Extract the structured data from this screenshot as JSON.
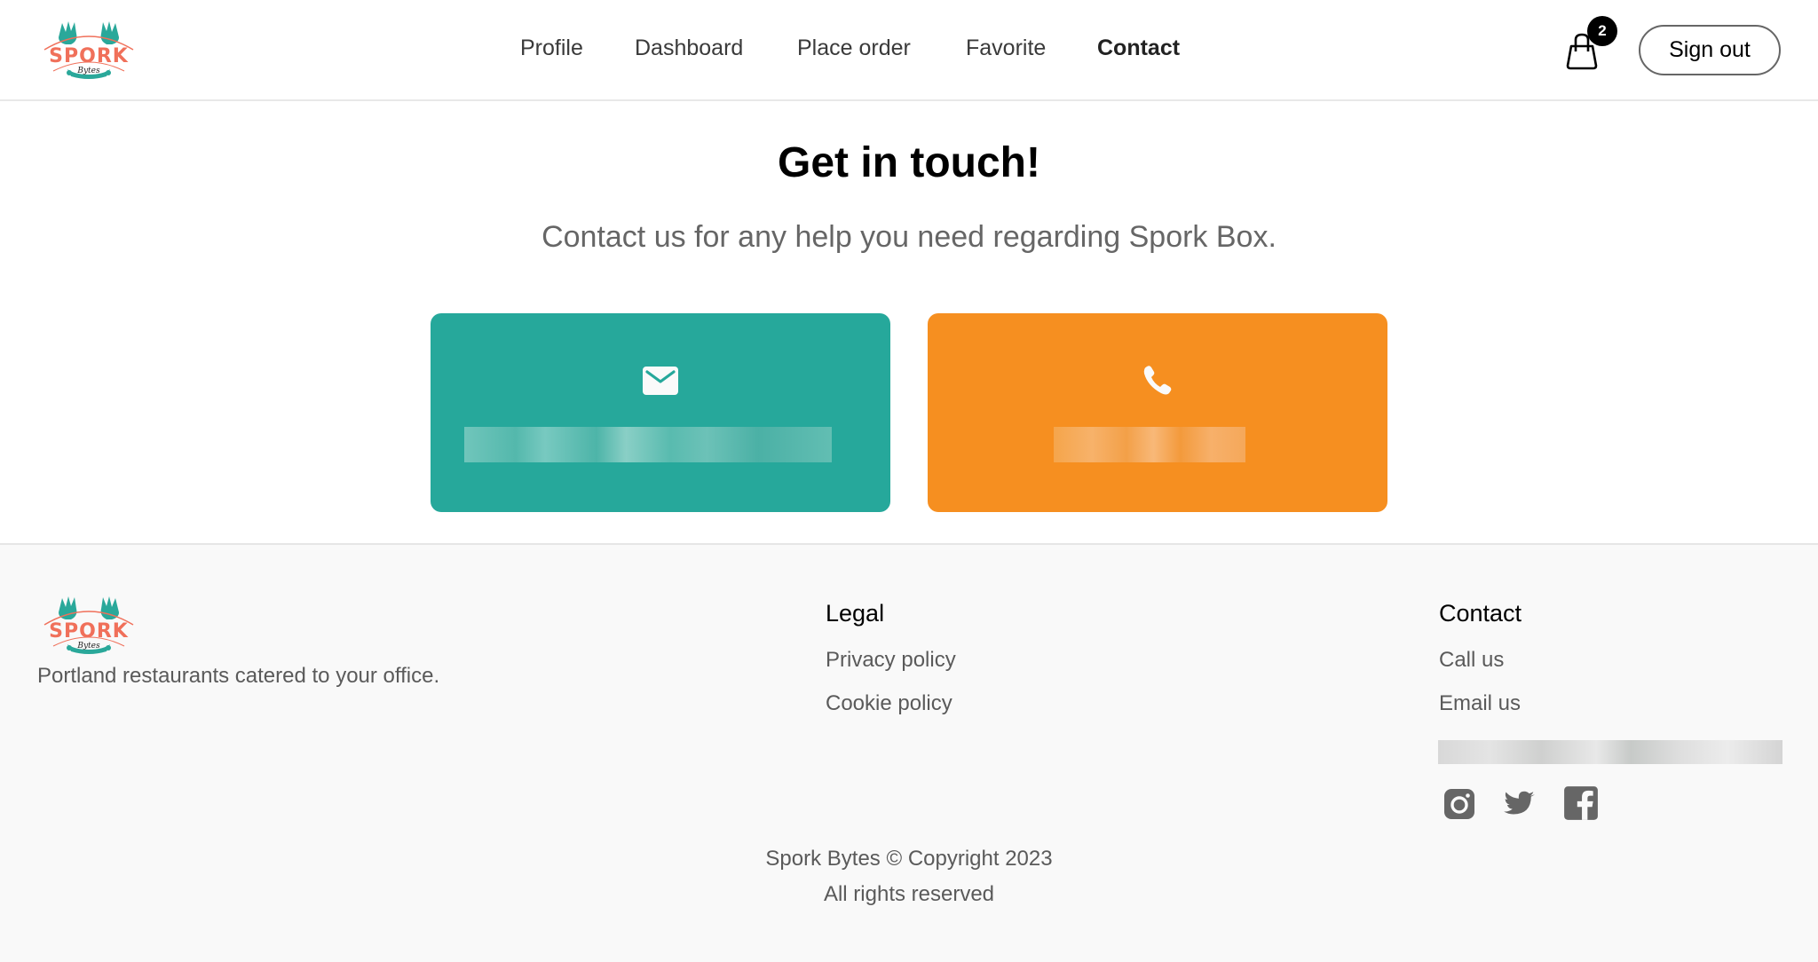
{
  "header": {
    "logo_alt": "Spork Bytes",
    "nav": [
      {
        "label": "Profile",
        "active": false
      },
      {
        "label": "Dashboard",
        "active": false
      },
      {
        "label": "Place order",
        "active": false
      },
      {
        "label": "Favorite",
        "active": false
      },
      {
        "label": "Contact",
        "active": true
      }
    ],
    "cart": {
      "icon": "shopping-bag-icon",
      "count": "2"
    },
    "signout_label": "Sign out"
  },
  "main": {
    "title": "Get in touch!",
    "subtitle": "Contact us for any help you need regarding Spork Box.",
    "cards": [
      {
        "type": "email",
        "icon": "envelope-icon",
        "value": "[redacted]",
        "color": "#26a89b"
      },
      {
        "type": "phone",
        "icon": "phone-icon",
        "value": "[redacted]",
        "color": "#f68f20"
      }
    ]
  },
  "footer": {
    "tagline": "Portland restaurants catered to your office.",
    "legal": {
      "title": "Legal",
      "links": [
        "Privacy policy",
        "Cookie policy"
      ]
    },
    "contact": {
      "title": "Contact",
      "links": [
        "Call us",
        "Email us"
      ],
      "address": "[redacted]"
    },
    "social": [
      "instagram-icon",
      "twitter-icon",
      "facebook-icon"
    ],
    "copyright_line1": "Spork Bytes © Copyright 2023",
    "copyright_line2": "All rights reserved"
  },
  "colors": {
    "brand_coral": "#f0705a",
    "brand_teal": "#2aa89a",
    "email_card": "#26a89b",
    "phone_card": "#f68f20",
    "footer_bg": "#f9f9f9"
  }
}
